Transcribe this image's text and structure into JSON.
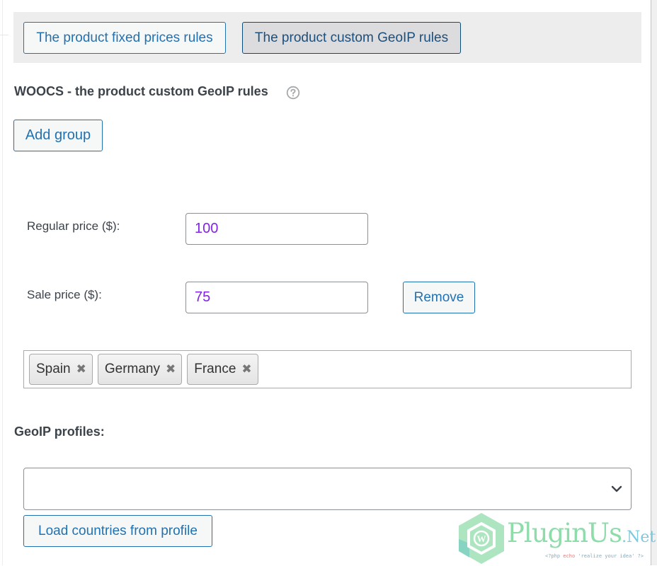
{
  "tabs": {
    "fixed_prices": "The product fixed prices rules",
    "custom_geoip": "The product custom GeoIP rules",
    "active": "custom_geoip"
  },
  "section": {
    "title": "WOOCS - the product custom GeoIP rules",
    "help_icon": "question-circle-icon"
  },
  "buttons": {
    "add_group": "Add group",
    "remove": "Remove",
    "load_countries": "Load countries from profile"
  },
  "group": {
    "regular_price_label": "Regular price ($):",
    "regular_price_value": "100",
    "sale_price_label": "Sale price ($):",
    "sale_price_value": "75",
    "countries": [
      {
        "name": "Spain",
        "remove_icon": "close-icon"
      },
      {
        "name": "Germany",
        "remove_icon": "close-icon"
      },
      {
        "name": "France",
        "remove_icon": "close-icon"
      }
    ]
  },
  "profiles": {
    "label": "GeoIP profiles:",
    "selected": ""
  },
  "logo": {
    "brand": "PluginUs",
    "suffix": ".Net",
    "tagline_open": "<?php",
    "tagline_kw": "echo",
    "tagline_rest": "'realize your idea' ?>"
  },
  "colors": {
    "accent": "#2271b1",
    "input_value": "#8224e3",
    "tabs_bar_bg": "#ededed"
  }
}
